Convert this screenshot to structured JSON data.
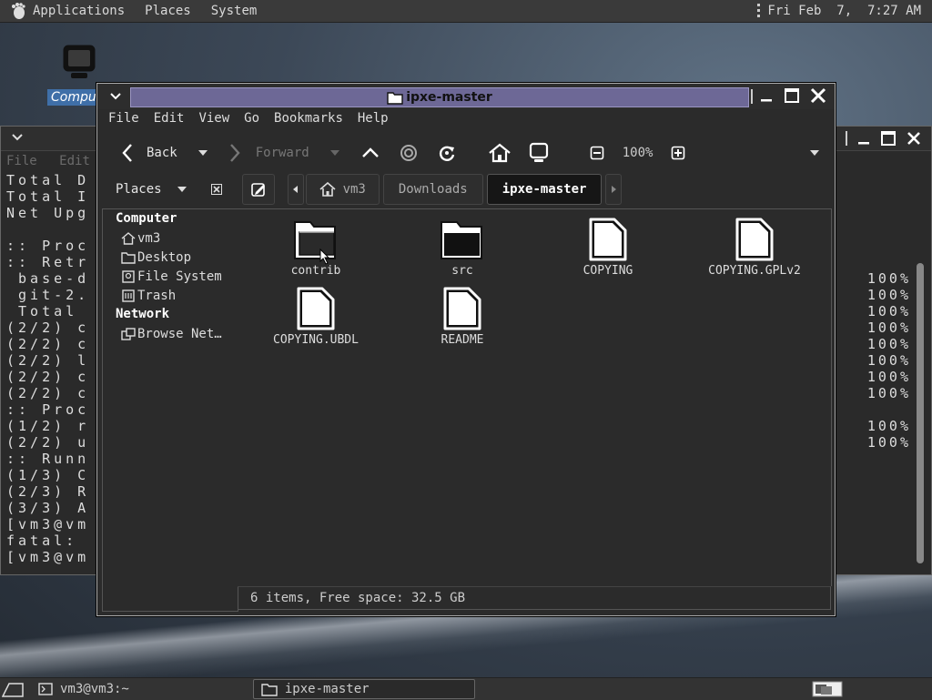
{
  "top_panel": {
    "menus": [
      "Applications",
      "Places",
      "System"
    ],
    "clock": "Fri Feb  7,  7:27 AM"
  },
  "desktop": {
    "icons": [
      {
        "label": "Computer",
        "icon": "computer-icon"
      }
    ]
  },
  "terminal": {
    "menu": [
      "File",
      "Edit"
    ],
    "lines": [
      "Total D",
      "Total I",
      "Net Upg",
      "",
      ":: Proc",
      ":: Retr",
      " base-d",
      " git-2.",
      " Total ",
      "(2/2) c",
      "(2/2) c",
      "(2/2) l",
      "(2/2) c",
      "(2/2) c",
      ":: Proc",
      "(1/2) r",
      "(2/2) u",
      ":: Runn",
      "(1/3) C",
      "(2/3) R",
      "(3/3) A",
      "[vm3@vm",
      "fatal: ",
      "[vm3@vm"
    ],
    "percents": [
      "100%",
      "100%",
      "100%",
      "100%",
      "100%",
      "100%",
      "100%",
      "100%",
      "",
      "100%",
      "100%"
    ]
  },
  "file_manager": {
    "title": "ipxe-master",
    "menubar": [
      "File",
      "Edit",
      "View",
      "Go",
      "Bookmarks",
      "Help"
    ],
    "toolbar": {
      "back": "Back",
      "forward": "Forward",
      "zoom": "100%"
    },
    "places_label": "Places",
    "breadcrumbs": [
      "vm3",
      "Downloads",
      "ipxe-master"
    ],
    "sidebar": {
      "computer_header": "Computer",
      "computer_items": [
        {
          "label": "vm3",
          "icon": "home-icon"
        },
        {
          "label": "Desktop",
          "icon": "folder-icon"
        },
        {
          "label": "File System",
          "icon": "drive-icon"
        },
        {
          "label": "Trash",
          "icon": "trash-icon"
        }
      ],
      "network_header": "Network",
      "network_items": [
        {
          "label": "Browse Net…",
          "icon": "network-icon"
        }
      ]
    },
    "files": [
      {
        "name": "contrib",
        "type": "folder-open"
      },
      {
        "name": "src",
        "type": "folder"
      },
      {
        "name": "COPYING",
        "type": "file"
      },
      {
        "name": "COPYING.GPLv2",
        "type": "file"
      },
      {
        "name": "COPYING.UBDL",
        "type": "file"
      },
      {
        "name": "README",
        "type": "file"
      }
    ],
    "status": "6 items, Free space: 32.5 GB"
  },
  "bottom_panel": {
    "tasks": [
      {
        "label": "vm3@vm3:~",
        "icon": "terminal-icon"
      },
      {
        "label": "ipxe-master",
        "icon": "folder-icon"
      }
    ]
  }
}
